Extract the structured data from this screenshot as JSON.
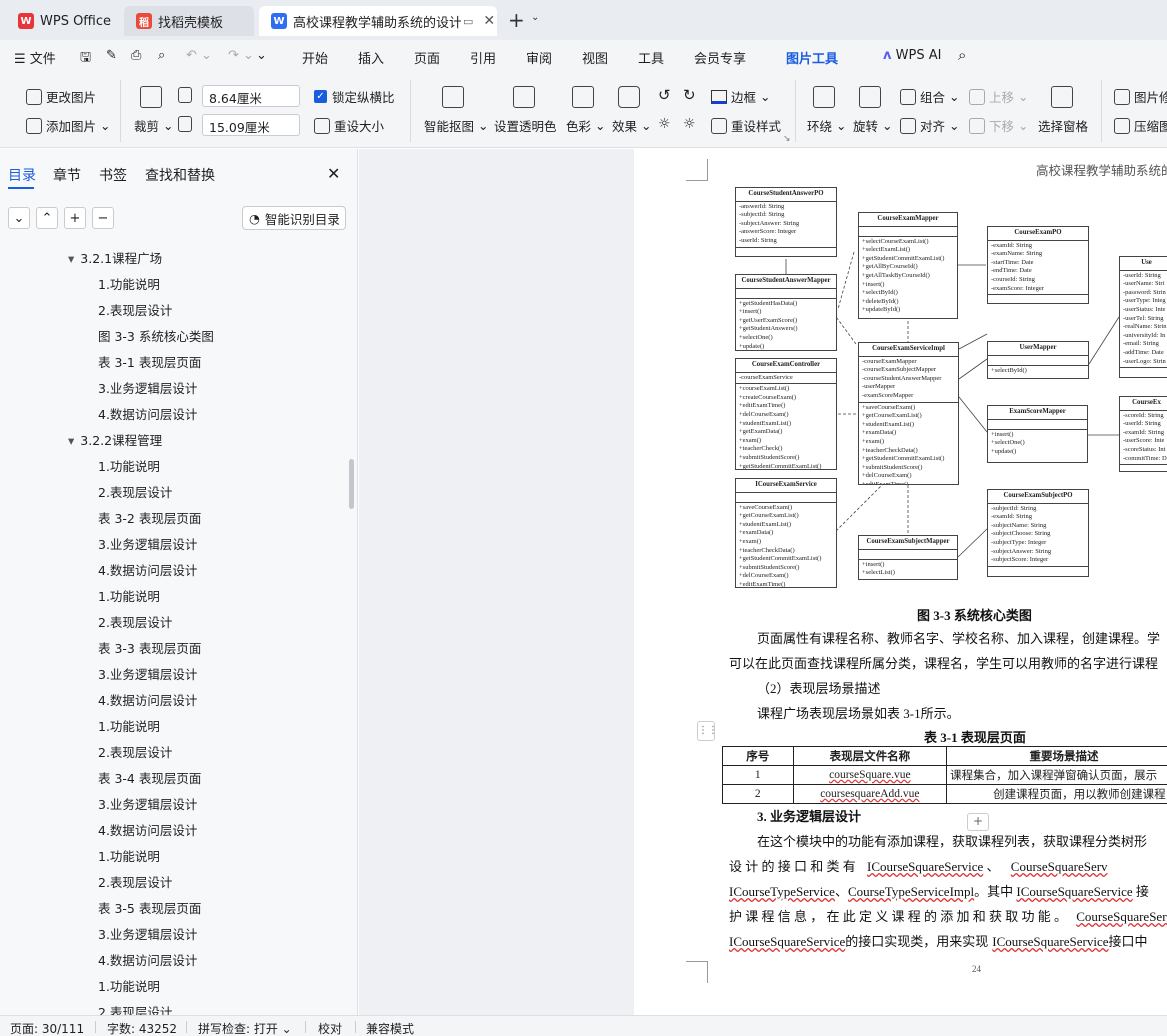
{
  "tabs": [
    {
      "label": "WPS Office",
      "icon": "wps-logo-icon"
    },
    {
      "label": "找稻壳模板",
      "icon": "docer-icon"
    },
    {
      "label": "高校课程教学辅助系统的设计与",
      "icon": "word-doc-icon"
    }
  ],
  "menu": {
    "file": "文件",
    "items": [
      "开始",
      "插入",
      "页面",
      "引用",
      "审阅",
      "视图",
      "工具",
      "会员专享",
      "图片工具"
    ],
    "active": "图片工具",
    "wps_ai": "WPS AI"
  },
  "ribbon": {
    "change_image": "更改图片",
    "add_image": "添加图片",
    "crop": "裁剪",
    "width_value": "8.64厘米",
    "height_value": "15.09厘米",
    "lock_ratio": "锁定纵横比",
    "reset_size": "重设大小",
    "smart_cutout": "智能抠图",
    "set_transparent": "设置透明色",
    "color": "色彩",
    "effect": "效果",
    "border": "边框",
    "reset_style": "重设样式",
    "wrap": "环绕",
    "rotate": "旋转",
    "group": "组合",
    "align": "对齐",
    "move_up": "上移",
    "move_down": "下移",
    "selection_pane": "选择窗格",
    "image_repair": "图片修",
    "compress": "压缩图"
  },
  "panel": {
    "tabs": [
      "目录",
      "章节",
      "书签",
      "查找和替换"
    ],
    "smart_toc": "智能识别目录",
    "items": [
      {
        "level": 1,
        "label": "3.2.1课程广场"
      },
      {
        "level": 2,
        "label": "1.功能说明"
      },
      {
        "level": 2,
        "label": "2.表现层设计"
      },
      {
        "level": 2,
        "label": "图 3-3  系统核心类图"
      },
      {
        "level": 2,
        "label": "表 3-1  表现层页面"
      },
      {
        "level": 2,
        "label": "3.业务逻辑层设计"
      },
      {
        "level": 2,
        "label": "4.数据访问层设计"
      },
      {
        "level": 1,
        "label": "3.2.2课程管理"
      },
      {
        "level": 2,
        "label": "1.功能说明"
      },
      {
        "level": 2,
        "label": "2.表现层设计"
      },
      {
        "level": 2,
        "label": "表 3-2  表现层页面"
      },
      {
        "level": 2,
        "label": "3.业务逻辑层设计"
      },
      {
        "level": 2,
        "label": "4.数据访问层设计"
      },
      {
        "level": 2,
        "label": "1.功能说明"
      },
      {
        "level": 2,
        "label": "2.表现层设计"
      },
      {
        "level": 2,
        "label": "表 3-3  表现层页面"
      },
      {
        "level": 2,
        "label": "3.业务逻辑层设计"
      },
      {
        "level": 2,
        "label": "4.数据访问层设计"
      },
      {
        "level": 2,
        "label": "1.功能说明"
      },
      {
        "level": 2,
        "label": "2.表现层设计"
      },
      {
        "level": 2,
        "label": "表 3-4  表现层页面"
      },
      {
        "level": 2,
        "label": "3.业务逻辑层设计"
      },
      {
        "level": 2,
        "label": "4.数据访问层设计"
      },
      {
        "level": 2,
        "label": "1.功能说明"
      },
      {
        "level": 2,
        "label": "2.表现层设计"
      },
      {
        "level": 2,
        "label": "表 3-5  表现层页面"
      },
      {
        "level": 2,
        "label": "3.业务逻辑层设计"
      },
      {
        "level": 2,
        "label": "4.数据访问层设计"
      },
      {
        "level": 2,
        "label": "1.功能说明"
      },
      {
        "level": 2,
        "label": "2.表现层设计"
      }
    ]
  },
  "doc": {
    "header": "高校课程教学辅助系统的",
    "uml": {
      "answerPO": {
        "title": "CourseStudentAnswerPO",
        "fields": [
          "-answerId: String",
          "-subjectId: String",
          "-subjectAnswer: String",
          "-answerScore: Integer",
          "-userId: String"
        ]
      },
      "answerMapper": {
        "title": "CourseStudentAnswerMapper",
        "methods": [
          "+getStudentHasData()",
          "+insert()",
          "+getUserExamScore()",
          "+getStudentAnswers()",
          "+selectOne()",
          "+update()"
        ]
      },
      "controller": {
        "title": "CourseExamController",
        "fields": [
          "-courseExamService"
        ],
        "methods": [
          "+courseExamList()",
          "+createCourseExam()",
          "+editExamTime()",
          "+delCourseExam()",
          "+studentExamList()",
          "+getExamData()",
          "+exam()",
          "+teacherCheck()",
          "+submitStudentScore()",
          "+getStudentCommitExamList()"
        ]
      },
      "iservice": {
        "title": "ICourseExamService",
        "methods": [
          "+saveCourseExam()",
          "+getCourseExamList()",
          "+studentExamList()",
          "+examData()",
          "+exam()",
          "+teacherCheckData()",
          "+getStudentCommitExamList()",
          "+submitStudentScore()",
          "+delCourseExam()",
          "+editExamTime()"
        ]
      },
      "examMapper": {
        "title": "CourseExamMapper",
        "methods": [
          "+selectCourseExamList()",
          "+selectExamList()",
          "+getStudentCommitExamList()",
          "+getAllByCourseId()",
          "+getAllTaskByCourseId()",
          "+insert()",
          "+selectById()",
          "+deleteById()",
          "+updateById()"
        ]
      },
      "serviceImpl": {
        "title": "CourseExamServiceImpl",
        "fields": [
          "-courseExamMapper",
          "-courseExamSubjectMapper",
          "-courseStudentAnswerMapper",
          "-userMapper",
          "-examScoreMapper"
        ],
        "methods": [
          "+saveCourseExam()",
          "+getCourseExamList()",
          "+studentExamList()",
          "+examData()",
          "+exam()",
          "+teacherCheckData()",
          "+getStudentCommitExamList()",
          "+submitStudentScore()",
          "+delCourseExam()",
          "+editExamTime()"
        ]
      },
      "subjectMapper": {
        "title": "CourseExamSubjectMapper",
        "methods": [
          "+insert()",
          "+selectList()"
        ]
      },
      "examPO": {
        "title": "CourseExamPO",
        "fields": [
          "-examId: String",
          "-examName: String",
          "-startTime: Date",
          "-endTime: Date",
          "-courseId: String",
          "-examScore: Integer"
        ]
      },
      "userMapper": {
        "title": "UserMapper",
        "methods": [
          "+selectById()"
        ]
      },
      "scoreMapper": {
        "title": "ExamScoreMapper",
        "methods": [
          "+insert()",
          "+selectOne()",
          "+update()"
        ]
      },
      "subjectPO": {
        "title": "CourseExamSubjectPO",
        "fields": [
          "-subjectId: String",
          "-examId: String",
          "-subjectName: String",
          "-subjectChoose: String",
          "-subjectType: Integer",
          "-subjectAnswer: String",
          "-subjectScore: Integer"
        ]
      },
      "userPO": {
        "title": "Use",
        "fields": [
          "-userId: String",
          "-userName: Stri",
          "-password: Strin",
          "-userType: Integ",
          "-userStatus: Inte",
          "-userTel: String",
          "-realName: Strin",
          "-universityId: In",
          "-email: String",
          "-addTime: Date",
          "-userLogo: Strin"
        ]
      },
      "scorePO": {
        "title": "CourseEx",
        "fields": [
          "-scoreId: String",
          "-userId: String",
          "-examId: String",
          "-userScore: Inte",
          "-scoreStatus: Int",
          "-commitTime: D"
        ]
      }
    },
    "fig_caption": "图 3-3  系统核心类图",
    "p1a": "页面属性有课程名称、教师名字、学校名称、加入课程，创建课程。学",
    "p1b": "可以在此页面查找课程所属分类，课程名，学生可以用教师的名字进行课程",
    "p2": "（2）表现层场景描述",
    "p3": "课程广场表现层场景如表  3-1所示。",
    "table_caption": "表 3-1  表现层页面",
    "table": {
      "headers": [
        "序号",
        "表现层文件名称",
        "重要场景描述"
      ],
      "rows": [
        [
          "1",
          "courseSquare.vue",
          "课程集合，加入课程弹窗确认页面，展示"
        ],
        [
          "2",
          "coursesquareAdd.vue",
          "创建课程页面，用以教师创建课程"
        ]
      ]
    },
    "h3": "3.  业务逻辑层设计",
    "p4": "在这个模块中的功能有添加课程，获取课程列表，获取课程分类树形",
    "p5a": "设 计 的 接 口 和 类 有",
    "p5b": "ICourseSquareService",
    "p5c": "、",
    "p5d": "CourseSquareServ",
    "p6a": "ICourseTypeService",
    "p6b": "、",
    "p6c": "CourseTypeServiceImpl",
    "p6d": "。其中",
    "p6e": "ICourseSquareService",
    "p6f": "接",
    "p7a": "护 课 程 信 息 ， 在 此 定 义 课 程 的 添 加 和 获 取 功 能 。",
    "p7b": "CourseSquareServ",
    "p8a": "ICourseSquareService",
    "p8b": "的接口实现类，用来实现",
    "p8c": "ICourseSquareService",
    "p8d": "接口中",
    "page_number": "24"
  },
  "status": {
    "page": "页面: 30/111",
    "words": "字数: 43252",
    "spell": "拼写检查: 打开",
    "proof": "校对",
    "compat": "兼容模式"
  }
}
